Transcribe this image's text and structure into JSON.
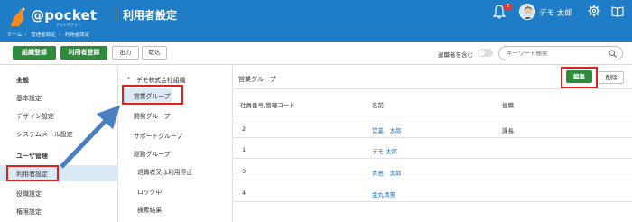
{
  "header": {
    "brand": "@pocket",
    "brand_sub": "アットポケット",
    "title": "利用者設定",
    "breadcrumb": [
      "ホーム",
      "管理者設定",
      "利用者設定"
    ],
    "notification_count": "3",
    "user_name": "デモ 太郎",
    "accent_color": "#1f7cc6"
  },
  "toolbar": {
    "bulk_register": "組織登録",
    "user_register": "利用者登録",
    "export": "出力",
    "import": "取込",
    "retired_label": "退職者を含む",
    "search_placeholder": "キーワード検索"
  },
  "sidebar": {
    "sections": [
      {
        "heading": "全般",
        "items": [
          "基本設定",
          "デザイン設定",
          "システムメール設定"
        ]
      },
      {
        "heading": "ユーザ管理",
        "items": [
          "利用者設定",
          "役職設定",
          "権限設定"
        ]
      }
    ],
    "active_item": "利用者設定"
  },
  "tree": {
    "root": "デモ株式会社組織",
    "groups": [
      "営業グループ",
      "開発グループ",
      "サポートグループ",
      "総務グループ"
    ],
    "selected": "営業グループ",
    "extra": [
      "退職者又は利用停止",
      "ロック中",
      "検索結果"
    ]
  },
  "content": {
    "group_title": "営業グループ",
    "edit_button": "編集",
    "delete_button": "削除",
    "columns": [
      "社員番号/管理コード",
      "名前",
      "役職"
    ],
    "rows": [
      {
        "id": "2",
        "name": "営業　太郎",
        "position": "課長"
      },
      {
        "id": "1",
        "name": "デモ 太郎",
        "position": ""
      },
      {
        "id": "3",
        "name": "青島　太郎",
        "position": ""
      },
      {
        "id": "4",
        "name": "金丸清美",
        "position": ""
      }
    ]
  },
  "colors": {
    "primary_green": "#2e8b3a",
    "highlight_red": "#e0221e",
    "link_blue": "#1f6fc0"
  }
}
